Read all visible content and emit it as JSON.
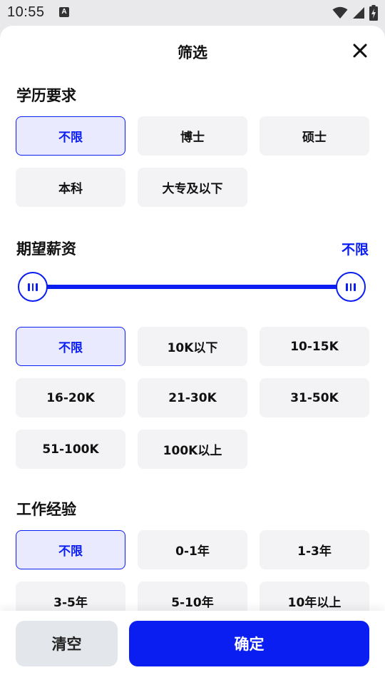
{
  "status_bar": {
    "time": "10:55",
    "app_icon_letter": "A",
    "icons": [
      "wifi-icon",
      "signal-icon",
      "battery-charging-icon"
    ]
  },
  "sheet": {
    "title": "筛选",
    "close_icon": "close-icon"
  },
  "education": {
    "title": "学历要求",
    "options": [
      {
        "label": "不限",
        "selected": true
      },
      {
        "label": "博士",
        "selected": false
      },
      {
        "label": "硕士",
        "selected": false
      },
      {
        "label": "本科",
        "selected": false
      },
      {
        "label": "大专及以下",
        "selected": false
      }
    ]
  },
  "salary": {
    "title": "期望薪资",
    "value": "不限",
    "range_fraction": [
      0,
      1
    ],
    "options": [
      {
        "label": "不限",
        "selected": true
      },
      {
        "label": "10K以下",
        "selected": false
      },
      {
        "label": "10-15K",
        "selected": false
      },
      {
        "label": "16-20K",
        "selected": false
      },
      {
        "label": "21-30K",
        "selected": false
      },
      {
        "label": "31-50K",
        "selected": false
      },
      {
        "label": "51-100K",
        "selected": false
      },
      {
        "label": "100K以上",
        "selected": false
      }
    ]
  },
  "experience": {
    "title": "工作经验",
    "options": [
      {
        "label": "不限",
        "selected": true
      },
      {
        "label": "0-1年",
        "selected": false
      },
      {
        "label": "1-3年",
        "selected": false
      },
      {
        "label": "3-5年",
        "selected": false
      },
      {
        "label": "5-10年",
        "selected": false
      },
      {
        "label": "10年以上",
        "selected": false
      }
    ]
  },
  "footer": {
    "clear_label": "清空",
    "confirm_label": "确定"
  },
  "colors": {
    "accent": "#0a1ef2",
    "chip_bg": "#f3f3f5",
    "chip_selected_bg": "#eaeaff",
    "clear_bg": "#e3e6ea"
  }
}
